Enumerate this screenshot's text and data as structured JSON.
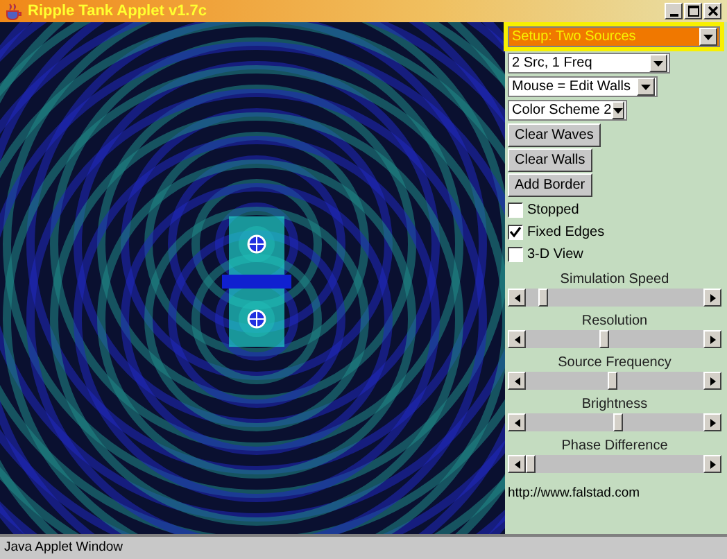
{
  "window": {
    "title": "Ripple Tank Applet v1.7c"
  },
  "dropdowns": [
    {
      "value": "Setup: Two Sources",
      "focused": true
    },
    {
      "value": "2 Src, 1 Freq",
      "focused": false
    },
    {
      "value": "Mouse = Edit Walls",
      "focused": false
    },
    {
      "value": "Color Scheme 2",
      "focused": false
    }
  ],
  "buttons": [
    "Clear Waves",
    "Clear Walls",
    "Add Border"
  ],
  "checkboxes": [
    {
      "label": "Stopped",
      "checked": false
    },
    {
      "label": "Fixed Edges",
      "checked": true
    },
    {
      "label": "3-D View",
      "checked": false
    }
  ],
  "sliders": [
    {
      "label": "Simulation Speed",
      "level": 0.1
    },
    {
      "label": "Resolution",
      "level": 0.44
    },
    {
      "label": "Source Frequency",
      "level": 0.49
    },
    {
      "label": "Brightness",
      "level": 0.52
    },
    {
      "label": "Phase Difference",
      "level": 0.02
    }
  ],
  "link": "http://www.falstad.com",
  "status_bar": "Java Applet Window"
}
